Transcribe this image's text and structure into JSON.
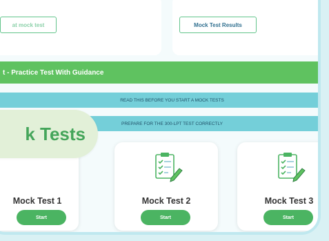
{
  "header": {
    "left_button_label": "at mock test",
    "right_button_label": "Mock Test Results"
  },
  "section_title": "t - Practice Test With Guidance",
  "notices": [
    "READ THIS BEFORE YOU START A MOCK TESTS",
    "PREPARE FOR THE 300-LPT TEST CORRECTLY"
  ],
  "overlay_label": "k Tests",
  "cards": [
    {
      "title": "Mock Test 1",
      "button": "Start"
    },
    {
      "title": "Mock Test 2",
      "button": "Start",
      "icon": "checklist-pencil-icon"
    },
    {
      "title": "Mock Test 3",
      "button": "Start",
      "icon": "checklist-pencil-icon"
    }
  ],
  "colors": {
    "accent_green": "#5fc260",
    "notice_teal": "#74cfd9",
    "start_button": "#4bb462",
    "frame_border": "#bfe8ef"
  }
}
